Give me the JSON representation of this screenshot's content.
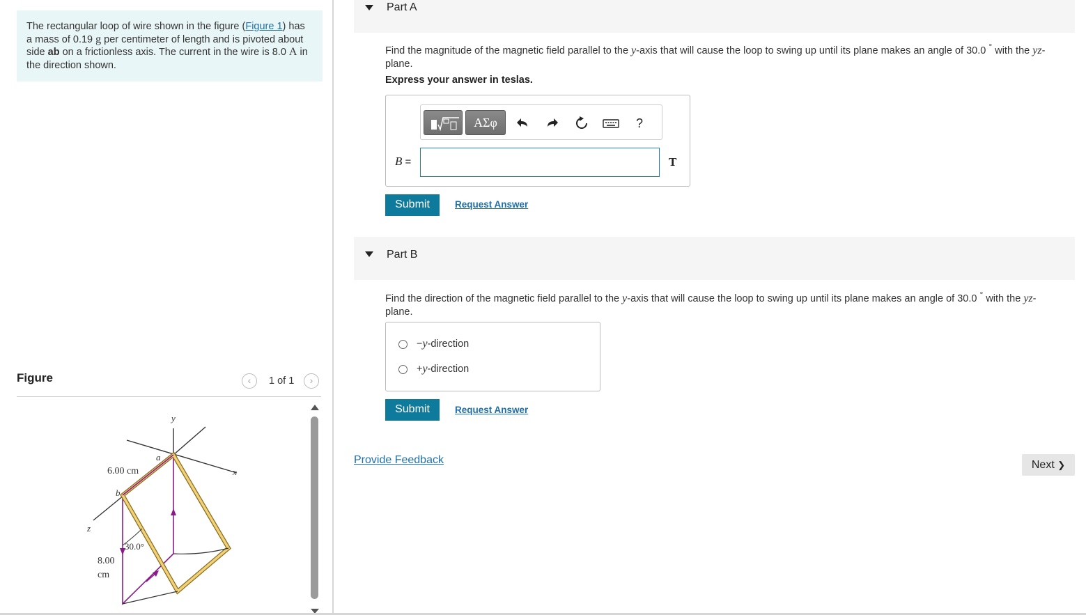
{
  "problem": {
    "text_1": "The rectangular loop of wire shown in the figure (",
    "figure_link": "Figure 1",
    "text_2": ") has a mass of 0.19 ",
    "unit_g": "g",
    "text_3": " per centimeter of length and is pivoted about side ",
    "side_ab": "ab",
    "text_4": " on a frictionless axis. The current in the wire is 8.0 ",
    "unit_A": "A",
    "text_5": " in the direction shown."
  },
  "figure": {
    "header": "Figure",
    "pager": "1 of 1",
    "prev_icon": "‹",
    "next_icon": "›",
    "labels": {
      "y_axis": "y",
      "x_axis": "x",
      "z_axis": "z",
      "point_a": "a",
      "point_b": "b",
      "width": "6.00 cm",
      "height_1": "8.00",
      "height_2": "cm",
      "angle": "30.0°"
    }
  },
  "part_a": {
    "title": "Part A",
    "question_1": "Find the magnitude of the magnetic field parallel to the ",
    "y_var": "y",
    "question_2": "-axis that will cause the loop to swing up until its plane makes an angle of 30.0 ",
    "degree": "°",
    "question_3": " with the ",
    "yz_var": "yz",
    "question_4": "-",
    "question_5": "plane.",
    "express": "Express your answer in teslas.",
    "toolbar": {
      "templates_icon": "fraction-sqrt-icon",
      "greek_label": "ΑΣφ",
      "undo_icon": "undo-icon",
      "redo_icon": "redo-icon",
      "reset_icon": "reset-icon",
      "keyboard_icon": "keyboard-icon",
      "help_label": "?"
    },
    "var_label": "B",
    "equals": " =",
    "input_value": "",
    "unit": "T",
    "submit": "Submit",
    "request": "Request Answer"
  },
  "part_b": {
    "title": "Part B",
    "question_1": "Find the direction of the magnetic field parallel to the ",
    "y_var": "y",
    "question_2": "-axis that will cause the loop to swing up until its plane makes an angle of 30.0 ",
    "degree": "°",
    "question_3": " with the ",
    "yz_var": "yz",
    "question_4": "-",
    "question_5": "plane.",
    "options": [
      {
        "sign": "−",
        "var": "y",
        "rest": "-direction"
      },
      {
        "sign": "+",
        "var": "y",
        "rest": "-direction"
      }
    ],
    "submit": "Submit",
    "request": "Request Answer"
  },
  "footer": {
    "feedback": "Provide Feedback",
    "next": "Next",
    "next_icon": "❯"
  },
  "colors": {
    "accent": "#0e7a9c",
    "link": "#1f6fa8",
    "problem_bg": "#e9f6f7",
    "loop_fill": "#f0d27a",
    "wire": "#8b1a8b"
  }
}
